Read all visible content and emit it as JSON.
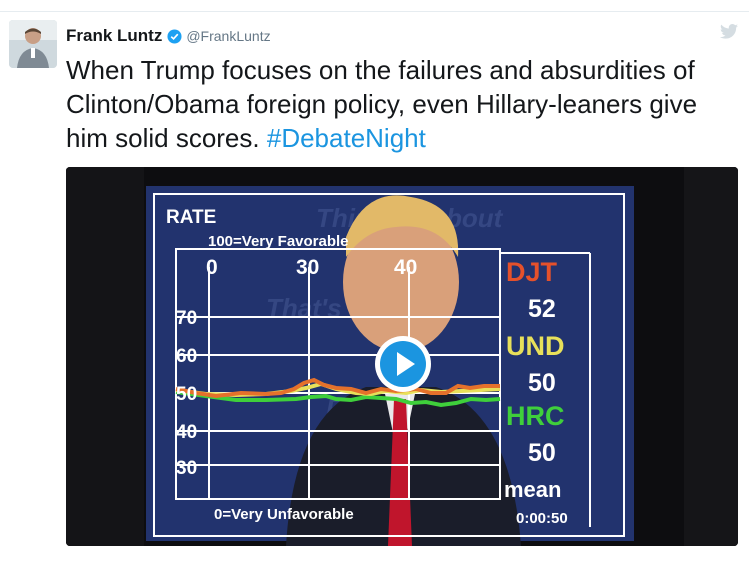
{
  "tweet": {
    "author_name": "Frank Luntz",
    "handle": "@FrankLuntz",
    "text_main": "When Trump focuses on the failures and absurdities of Clinton/Obama foreign policy, even Hillary-leaners give him solid scores.",
    "hashtag": "#DebateNight"
  },
  "icons": {
    "verified": "verified-badge-icon",
    "bird": "twitter-bird-icon",
    "play": "play-icon"
  },
  "colors": {
    "hashtag": "#1b95e0",
    "djt_label": "#e5512b",
    "und_label": "#e8e05a",
    "hrc_label": "#3fcf3b",
    "screen_blue": "#22336e"
  },
  "chart": {
    "title": "RATE",
    "top_label": "100=Very Favorable",
    "bottom_label": "0=Very Unfavorable",
    "top_ticks": [
      "0",
      "30",
      "40"
    ],
    "left_ticks": [
      "70",
      "60",
      "50",
      "40",
      "30"
    ],
    "legend": {
      "djt_name": "DJT",
      "djt_value": "52",
      "und_name": "UND",
      "und_value": "50",
      "hrc_name": "HRC",
      "hrc_value": "50",
      "stat_label": "mean",
      "timer": "0:00:50"
    }
  }
}
